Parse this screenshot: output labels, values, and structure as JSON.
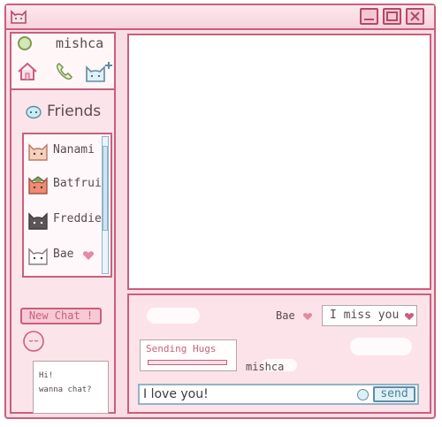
{
  "user": {
    "name": "mishca",
    "status": "online"
  },
  "nav": {
    "icons": [
      "home-icon",
      "phone-icon",
      "add-friend-icon"
    ]
  },
  "friends": {
    "title": "Friends",
    "list": [
      {
        "name": "Nanami"
      },
      {
        "name": "Batfruit"
      },
      {
        "name": "Freddie"
      },
      {
        "name": "Bae"
      }
    ]
  },
  "sidebar": {
    "new_chat_label": "New Chat !",
    "bubble_line1": "Hi!",
    "bubble_line2": "wanna chat?"
  },
  "conversation": {
    "incoming": {
      "sender": "Bae",
      "text": "I miss you"
    },
    "outgoing": {
      "sender": "mishca",
      "status": "Sending Hugs"
    }
  },
  "compose": {
    "value": "I love you!",
    "send_label": "send"
  },
  "colors": {
    "accent": "#c95f7d",
    "background": "#f8dde4",
    "blue": "#8fb4c8"
  }
}
